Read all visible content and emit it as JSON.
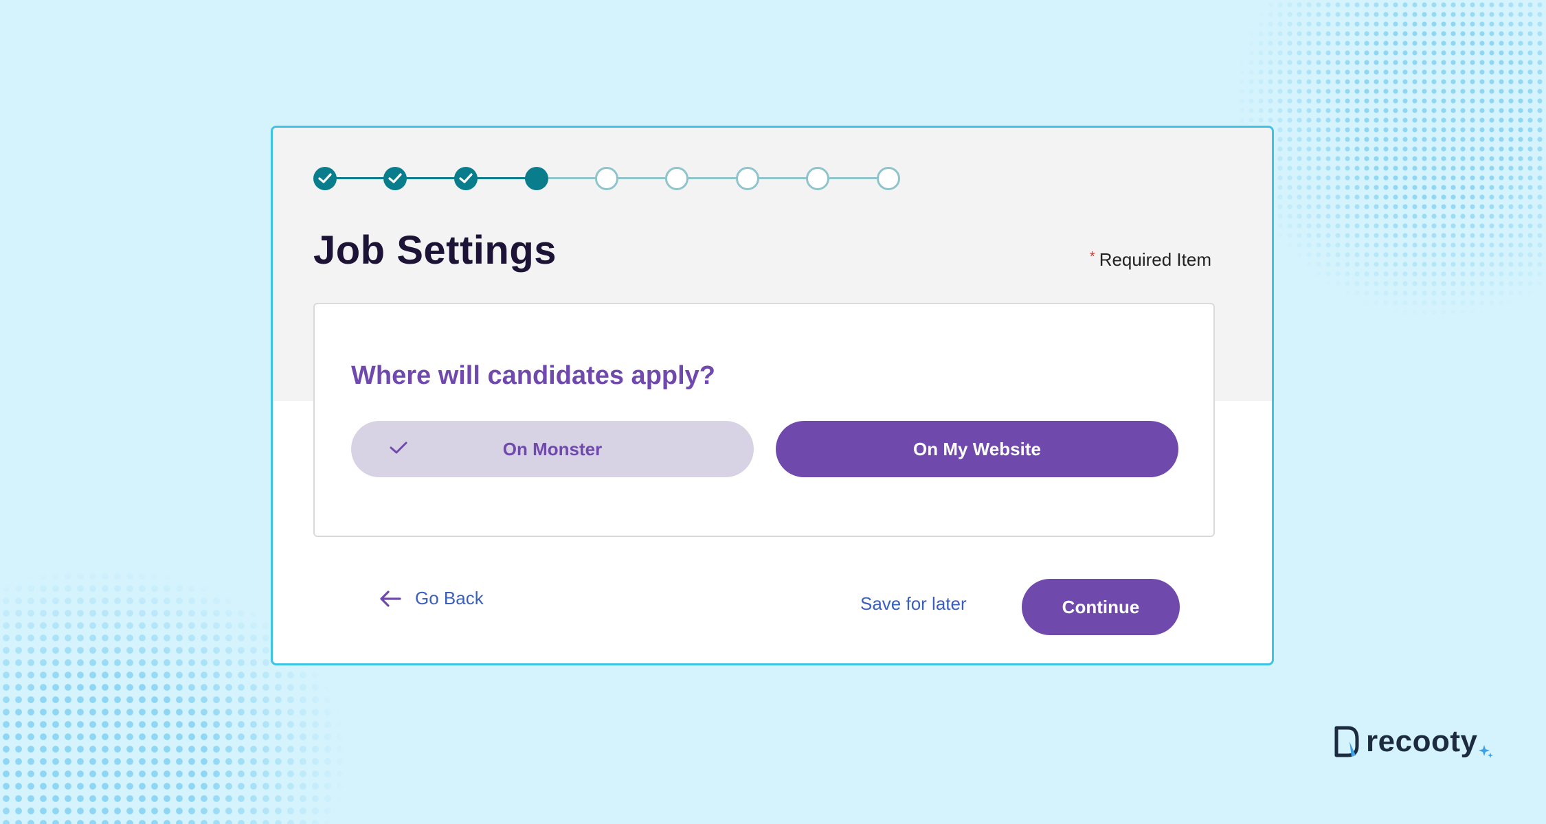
{
  "stepper": {
    "steps": [
      {
        "state": "done"
      },
      {
        "state": "done"
      },
      {
        "state": "done"
      },
      {
        "state": "current"
      },
      {
        "state": "todo"
      },
      {
        "state": "todo"
      },
      {
        "state": "todo"
      },
      {
        "state": "todo"
      },
      {
        "state": "todo"
      }
    ],
    "current_step": 4,
    "total_steps": 9
  },
  "page": {
    "title": "Job Settings",
    "required_star": "*",
    "required_label": "Required Item"
  },
  "question": {
    "text": "Where will candidates apply?",
    "options": [
      {
        "label": "On Monster",
        "selected": true
      },
      {
        "label": "On My Website",
        "selected": false
      }
    ]
  },
  "footer": {
    "go_back_label": "Go Back",
    "save_later_label": "Save for later",
    "continue_label": "Continue"
  },
  "brand": {
    "name": "recooty"
  },
  "colors": {
    "background": "#d4f3fd",
    "card_border": "#3cc3e6",
    "step_done": "#0a7d8c",
    "step_todo_border": "#8fc4cc",
    "accent_purple": "#7049ad",
    "option_selected_bg": "#d7d3e4",
    "link_blue": "#3a5fbf",
    "title_text": "#1d1336"
  },
  "icons": [
    "check-icon",
    "arrow-left-icon",
    "recooty-logo-icon",
    "sparkle-icon"
  ]
}
